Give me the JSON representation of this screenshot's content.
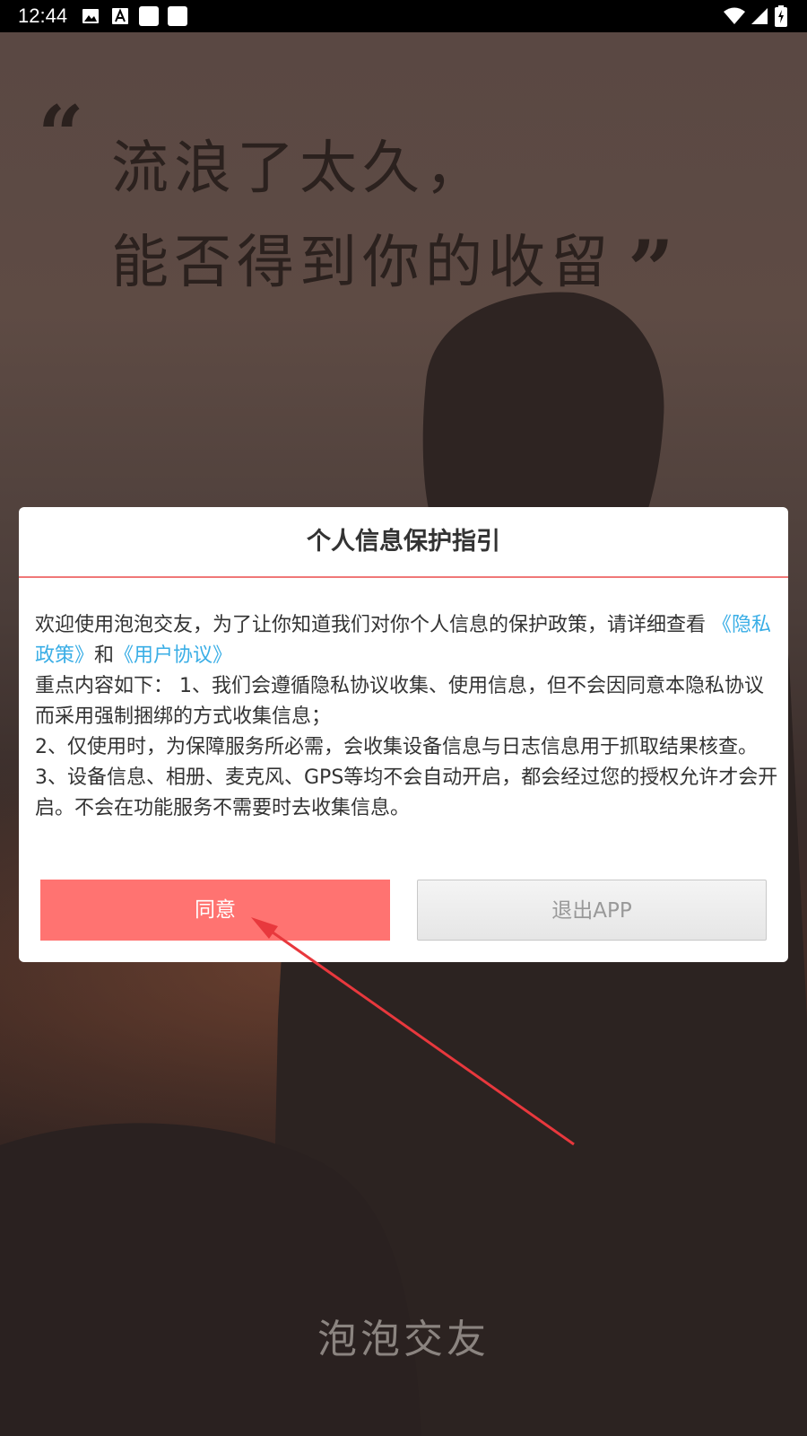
{
  "status_bar": {
    "time": "12:44",
    "icons": [
      "image-icon",
      "a-icon",
      "square-icon",
      "square-icon",
      "wifi-icon",
      "signal-icon",
      "battery-charging-icon"
    ]
  },
  "background": {
    "quote_open": "“",
    "quote_line_1": "流浪了太久，",
    "quote_line_2": "能否得到你的收留",
    "quote_close": "”",
    "brand_name": "泡泡交友"
  },
  "dialog": {
    "title": "个人信息保护指引",
    "intro": "欢迎使用泡泡交友，为了让你知道我们对你个人信息的保护政策，请详细查看",
    "privacy_link": "《隐私政策》",
    "and": "和",
    "user_agreement_link": "《用户协议》",
    "point_1": "重点内容如下： 1、我们会遵循隐私协议收集、使用信息，但不会因同意本隐私协议而采用强制捆绑的方式收集信息；",
    "point_2": " 2、仅使用时，为保障服务所必需，会收集设备信息与日志信息用于抓取结果核查。",
    "point_3": " 3、设备信息、相册、麦克风、GPS等均不会自动开启，都会经过您的授权允许才会开启。不会在功能服务不需要时去收集信息。",
    "agree_button": "同意",
    "exit_button": "退出APP"
  },
  "colors": {
    "accent": "#ff7371",
    "divider": "#f07878",
    "link": "#3aaee6",
    "annotation_arrow": "#e8383d"
  }
}
